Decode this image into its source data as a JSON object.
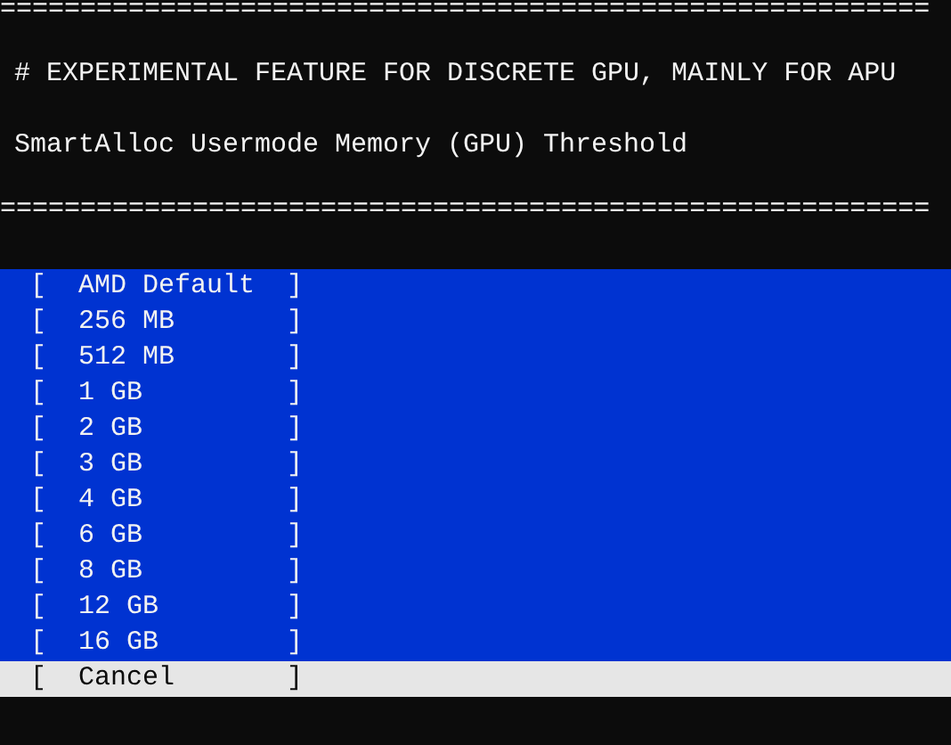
{
  "terminal": {
    "lines": [
      {
        "kind": "rule",
        "text": "=========================================================="
      },
      {
        "kind": "blank"
      },
      {
        "kind": "text",
        "text": "# EXPERIMENTAL FEATURE FOR DISCRETE GPU, MAINLY FOR APU"
      },
      {
        "kind": "blank"
      },
      {
        "kind": "text",
        "text": "SmartAlloc Usermode Memory (GPU) Threshold"
      },
      {
        "kind": "blank"
      },
      {
        "kind": "rule",
        "text": "=========================================================="
      }
    ]
  },
  "menu": {
    "items": [
      {
        "text": "[  AMD Default  ]",
        "selected": false
      },
      {
        "text": "[  256 MB       ]",
        "selected": false
      },
      {
        "text": "[  512 MB       ]",
        "selected": false
      },
      {
        "text": "[  1 GB         ]",
        "selected": false
      },
      {
        "text": "[  2 GB         ]",
        "selected": false
      },
      {
        "text": "[  3 GB         ]",
        "selected": false
      },
      {
        "text": "[  4 GB         ]",
        "selected": false
      },
      {
        "text": "[  6 GB         ]",
        "selected": false
      },
      {
        "text": "[  8 GB         ]",
        "selected": false
      },
      {
        "text": "[  12 GB        ]",
        "selected": false
      },
      {
        "text": "[  16 GB        ]",
        "selected": false
      },
      {
        "text": "[  Cancel       ]",
        "selected": true
      }
    ]
  }
}
